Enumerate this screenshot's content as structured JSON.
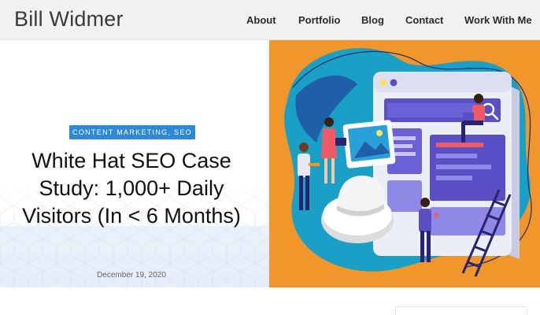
{
  "site": {
    "title": "Bill Widmer"
  },
  "nav": {
    "items": [
      {
        "label": "About"
      },
      {
        "label": "Portfolio"
      },
      {
        "label": "Blog"
      },
      {
        "label": "Contact"
      },
      {
        "label": "Work With Me"
      }
    ]
  },
  "post": {
    "category": "CONTENT MARKETING, SEO",
    "title": "White Hat SEO Case Study: 1,000+ Daily Visitors (In < 6 Months)",
    "date": "December 19, 2020"
  },
  "colors": {
    "header_bg": "#f1f1f1",
    "badge_bg": "#2e88d8",
    "hero_orange": "#f0962a",
    "blob_teal": "#1a9fc6",
    "screen_white": "#e9e9f3",
    "accent_purple": "#5a4fc4"
  },
  "icons": [
    "search-icon",
    "image-icon"
  ]
}
